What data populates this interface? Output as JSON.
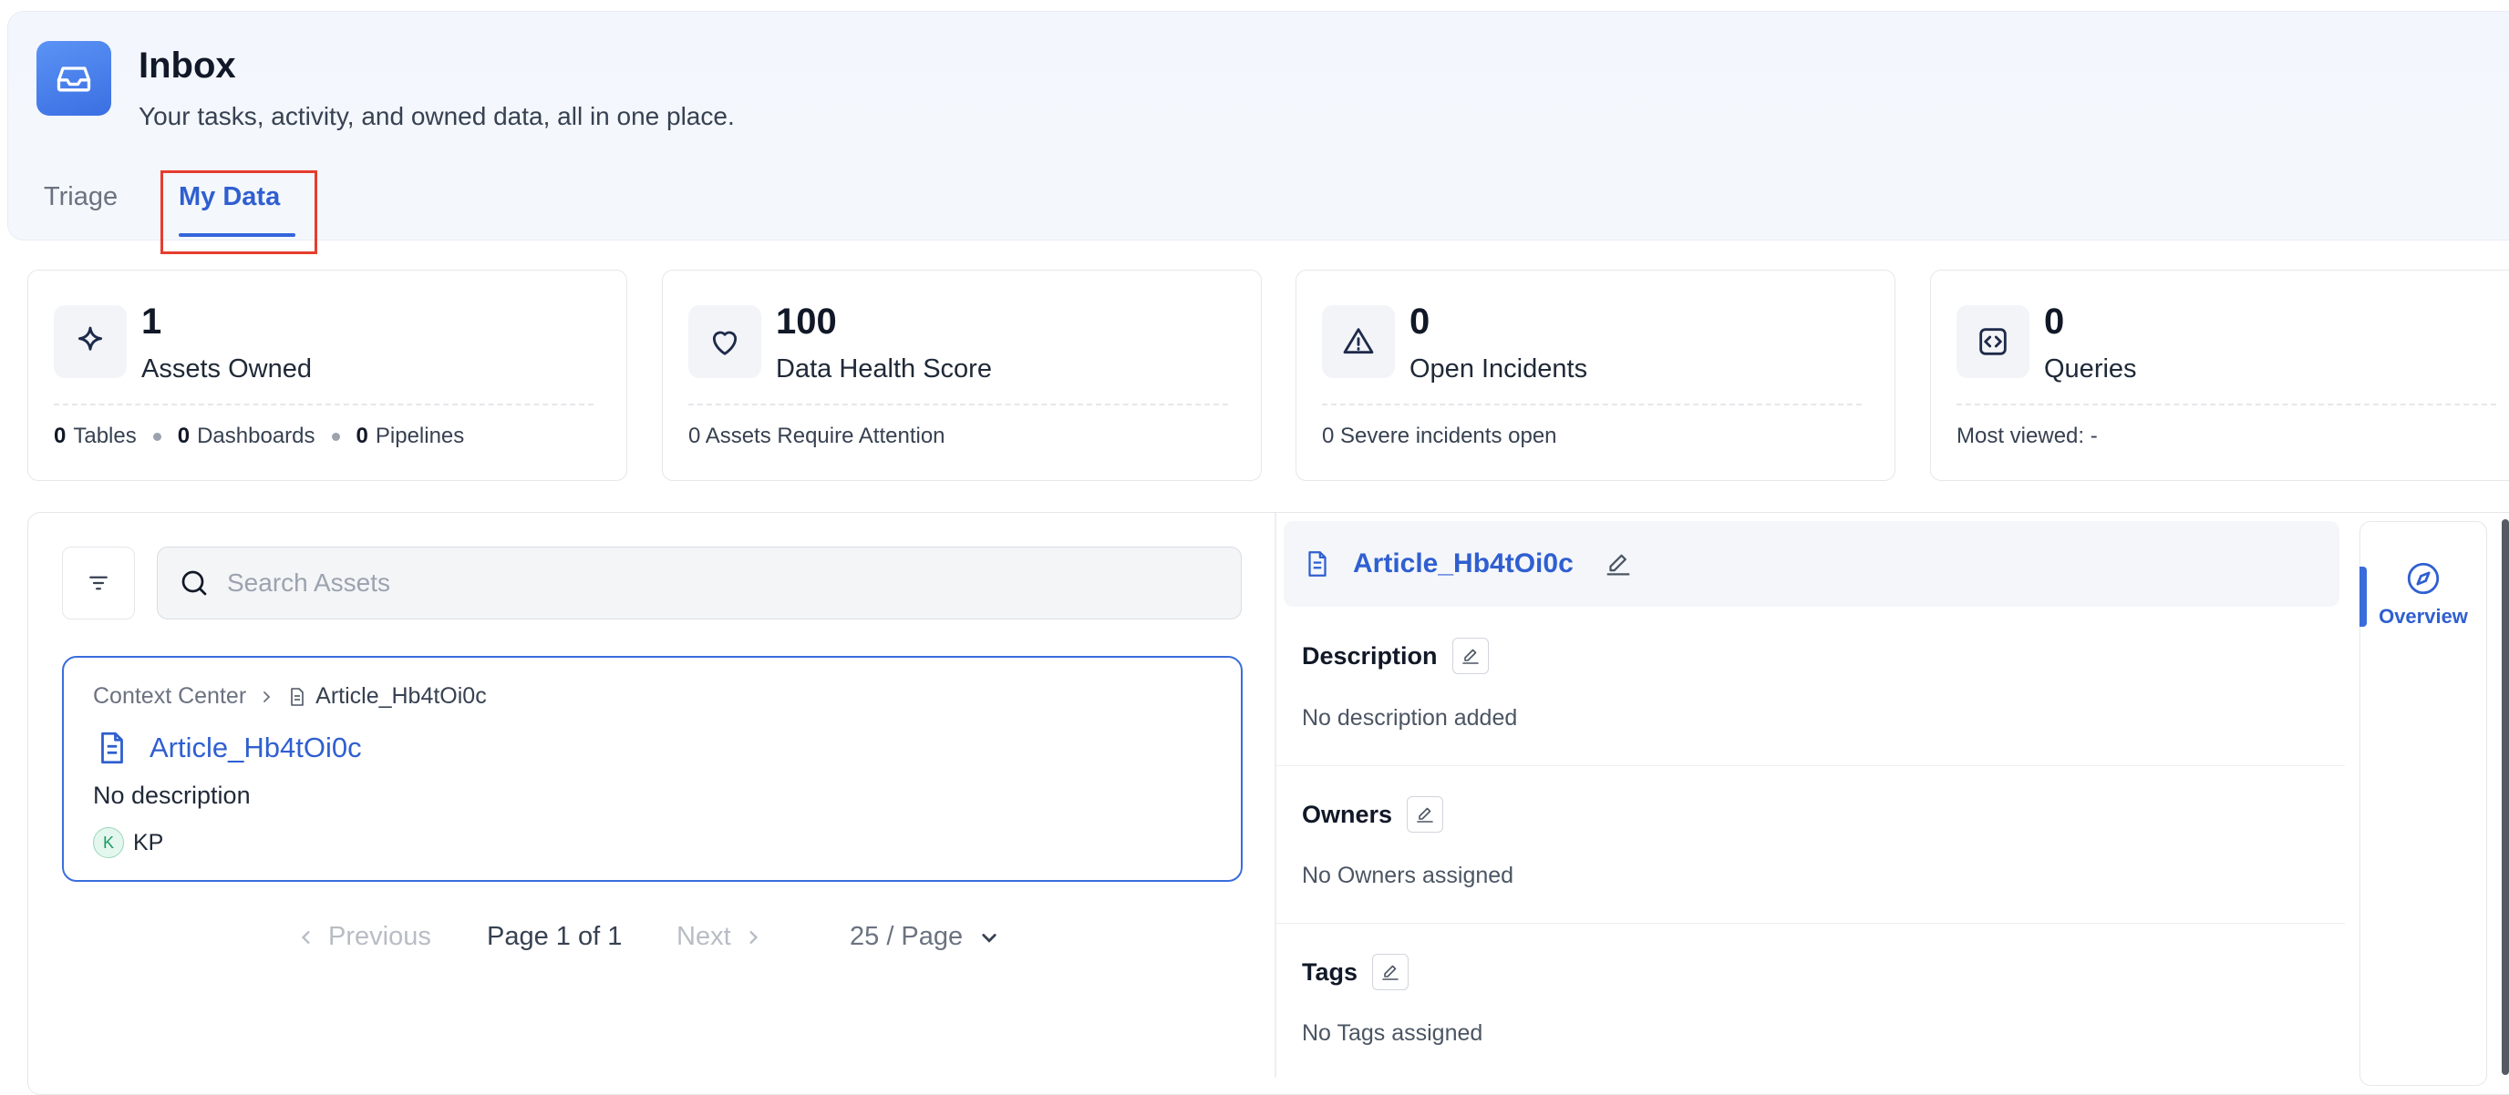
{
  "header": {
    "title": "Inbox",
    "subtitle": "Your tasks, activity, and owned data, all in one place.",
    "icon": "inbox-icon",
    "tabs": [
      {
        "label": "Triage",
        "active": false
      },
      {
        "label": "My Data",
        "active": true
      }
    ]
  },
  "stats": [
    {
      "icon": "sparkle-icon",
      "value": "1",
      "label": "Assets Owned",
      "footer_parts": [
        {
          "count": "0",
          "label": "Tables"
        },
        {
          "count": "0",
          "label": "Dashboards"
        },
        {
          "count": "0",
          "label": "Pipelines"
        }
      ]
    },
    {
      "icon": "heart-icon",
      "value": "100",
      "label": "Data Health Score",
      "footer": "0 Assets Require Attention"
    },
    {
      "icon": "warning-icon",
      "value": "0",
      "label": "Open Incidents",
      "footer": "0 Severe incidents open"
    },
    {
      "icon": "code-icon",
      "value": "0",
      "label": "Queries",
      "footer": "Most viewed: -"
    }
  ],
  "search": {
    "placeholder": "Search Assets",
    "value": ""
  },
  "asset": {
    "breadcrumb_root": "Context Center",
    "breadcrumb_current": "Article_Hb4tOi0c",
    "title": "Article_Hb4tOi0c",
    "description": "No description",
    "owner_initial": "K",
    "owner_name": "KP"
  },
  "pagination": {
    "previous": "Previous",
    "page_info": "Page 1 of 1",
    "next": "Next",
    "page_size": "25 / Page"
  },
  "detail": {
    "title": "Article_Hb4tOi0c",
    "sections": [
      {
        "title": "Description",
        "empty": "No description added"
      },
      {
        "title": "Owners",
        "empty": "No Owners assigned"
      },
      {
        "title": "Tags",
        "empty": "No Tags assigned"
      }
    ]
  },
  "rail": {
    "overview_label": "Overview"
  },
  "colors": {
    "accent": "#2f5fd0",
    "highlight": "#e53d2f",
    "owner_avatar": "#1d9a62"
  }
}
